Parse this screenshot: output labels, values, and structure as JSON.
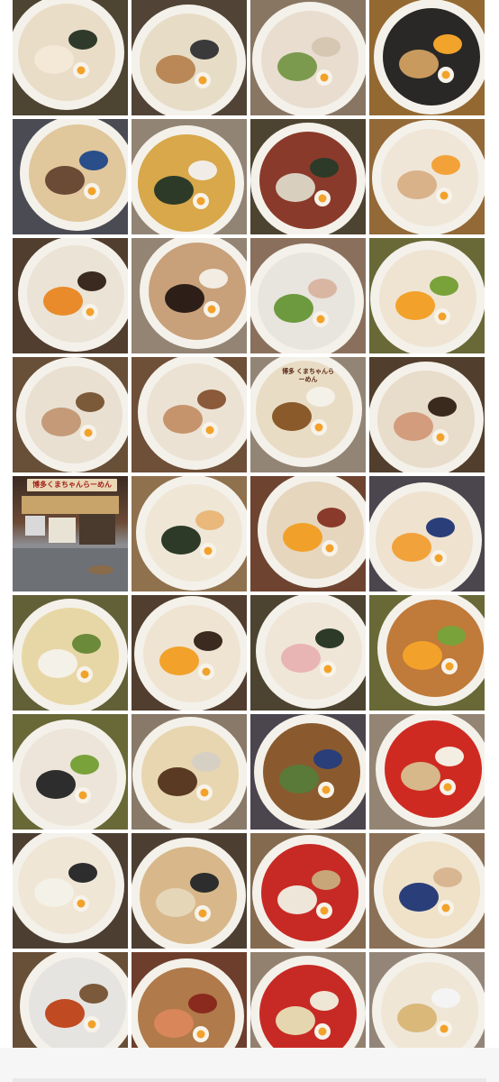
{
  "gallery": {
    "columns": 4,
    "rows": 9,
    "photos": [
      {
        "subject": "tonkotsu ramen with nori",
        "palette": [
          "#e9ddc8",
          "#f4e8d6",
          "#2f3a2a"
        ]
      },
      {
        "subject": "chashu ramen with scallions",
        "palette": [
          "#e7dcc6",
          "#b98856",
          "#3a3a3a"
        ]
      },
      {
        "subject": "white broth ramen with greens",
        "palette": [
          "#e8ddcf",
          "#7c9a4e",
          "#d6c7b2"
        ]
      },
      {
        "subject": "minced pork rice bowl with egg yolk",
        "palette": [
          "#2a2826",
          "#c89a5e",
          "#f2a32a"
        ]
      },
      {
        "subject": "ramen with seared chashu",
        "palette": [
          "#e0c79c",
          "#6b4a36",
          "#2a4e8a"
        ]
      },
      {
        "subject": "ramen with nori and egg",
        "palette": [
          "#d8a84a",
          "#2d3a28",
          "#f1ede6"
        ]
      },
      {
        "subject": "rice bowl with mayonnaise",
        "palette": [
          "#8a3a2a",
          "#d9cfbf",
          "#2d3a28"
        ]
      },
      {
        "subject": "tonkotsu ramen with chashu and egg",
        "palette": [
          "#efe6d8",
          "#d9b28a",
          "#f3a23a"
        ]
      },
      {
        "subject": "ramen with egg and wood ear",
        "palette": [
          "#ebe3d6",
          "#e98b2a",
          "#3a2a20"
        ]
      },
      {
        "subject": "black garlic ramen with egg",
        "palette": [
          "#c8a07a",
          "#2d1f18",
          "#f2ece2"
        ]
      },
      {
        "subject": "tonkotsu ramen with chashu",
        "palette": [
          "#e8e4de",
          "#6d9a3e",
          "#d9b6a2"
        ]
      },
      {
        "subject": "ramen with egg and chashu",
        "palette": [
          "#efe4d2",
          "#f2a22a",
          "#7aa23a"
        ]
      },
      {
        "subject": "chashu ramen bowl",
        "palette": [
          "#e9e0d2",
          "#c59a78",
          "#7b5a3a"
        ]
      },
      {
        "subject": "chashu ramen close-up",
        "palette": [
          "#ece2d4",
          "#c6946c",
          "#8a5a3a"
        ]
      },
      {
        "subject": "meat rice bowl with mayonnaise",
        "palette": [
          "#e9dcc4",
          "#8a5a2a",
          "#f4f1e8"
        ],
        "label": "博多\nくまちゃんらーめん"
      },
      {
        "subject": "chashu ramen with greens",
        "palette": [
          "#e8dccb",
          "#d39c7c",
          "#3a2a1e"
        ]
      },
      {
        "subject": "restaurant storefront",
        "palette": [
          "#3b2a22",
          "#8d8f93",
          "#e9d7b6"
        ],
        "sign": "博多くまちゃんらーめん"
      },
      {
        "subject": "ramen with nori and menma",
        "palette": [
          "#efe6d6",
          "#2d3a28",
          "#e9b87a"
        ]
      },
      {
        "subject": "ramen with eggs",
        "palette": [
          "#e6d6be",
          "#f1a12a",
          "#8a3a2a"
        ]
      },
      {
        "subject": "chashu ramen with eggs in blue bowl",
        "palette": [
          "#efe2cf",
          "#f2a23a",
          "#2a3e7a"
        ]
      },
      {
        "subject": "fried rice",
        "palette": [
          "#e8d7a6",
          "#f4f1e8",
          "#6b8a3a"
        ]
      },
      {
        "subject": "ramen with eggs and wood ear",
        "palette": [
          "#efe4d2",
          "#f2a22a",
          "#3a2a20"
        ]
      },
      {
        "subject": "pink ham ramen with nori",
        "palette": [
          "#efe6d8",
          "#e9b4b4",
          "#2d3a28"
        ]
      },
      {
        "subject": "chashu rice bowl with egg",
        "palette": [
          "#c07a3a",
          "#f2a22a",
          "#7aa23a"
        ]
      },
      {
        "subject": "tonkotsu ramen with spoon",
        "palette": [
          "#ede5d9",
          "#2d2d2d",
          "#7aa23a"
        ]
      },
      {
        "subject": "tsukemen dipping noodles",
        "palette": [
          "#e8d6b0",
          "#5a3a22",
          "#d6cfc4"
        ]
      },
      {
        "subject": "spicy miso ramen",
        "palette": [
          "#8a5a2e",
          "#5a7a3a",
          "#2a3e7a"
        ]
      },
      {
        "subject": "ramen set with noodles",
        "palette": [
          "#cf2a22",
          "#d6b88a",
          "#f4ede2"
        ]
      },
      {
        "subject": "ramen with eggs and greens",
        "palette": [
          "#efe6d6",
          "#f4f1e8",
          "#2d2d2d"
        ]
      },
      {
        "subject": "ramen with scallions",
        "palette": [
          "#d8b88a",
          "#e6d6b8",
          "#2d2d2d"
        ]
      },
      {
        "subject": "jiro style ramen",
        "palette": [
          "#c72a24",
          "#efe6da",
          "#c9a67a"
        ]
      },
      {
        "subject": "chashu ramen in patterned bowl",
        "palette": [
          "#efe2c8",
          "#2a3e7a",
          "#d9b692"
        ]
      },
      {
        "subject": "spicy noodle dish",
        "palette": [
          "#e6e4e0",
          "#c04a22",
          "#7a5a3a"
        ]
      },
      {
        "subject": "katsu set",
        "palette": [
          "#b07a4a",
          "#d9865a",
          "#8a2a1e"
        ]
      },
      {
        "subject": "ramen with bean sprouts and eggs",
        "palette": [
          "#c72a24",
          "#e6d6b0",
          "#f0e6d6"
        ]
      },
      {
        "subject": "ramen with gyoza",
        "palette": [
          "#efe6d6",
          "#d9b87a",
          "#f4f4f4"
        ]
      }
    ]
  }
}
